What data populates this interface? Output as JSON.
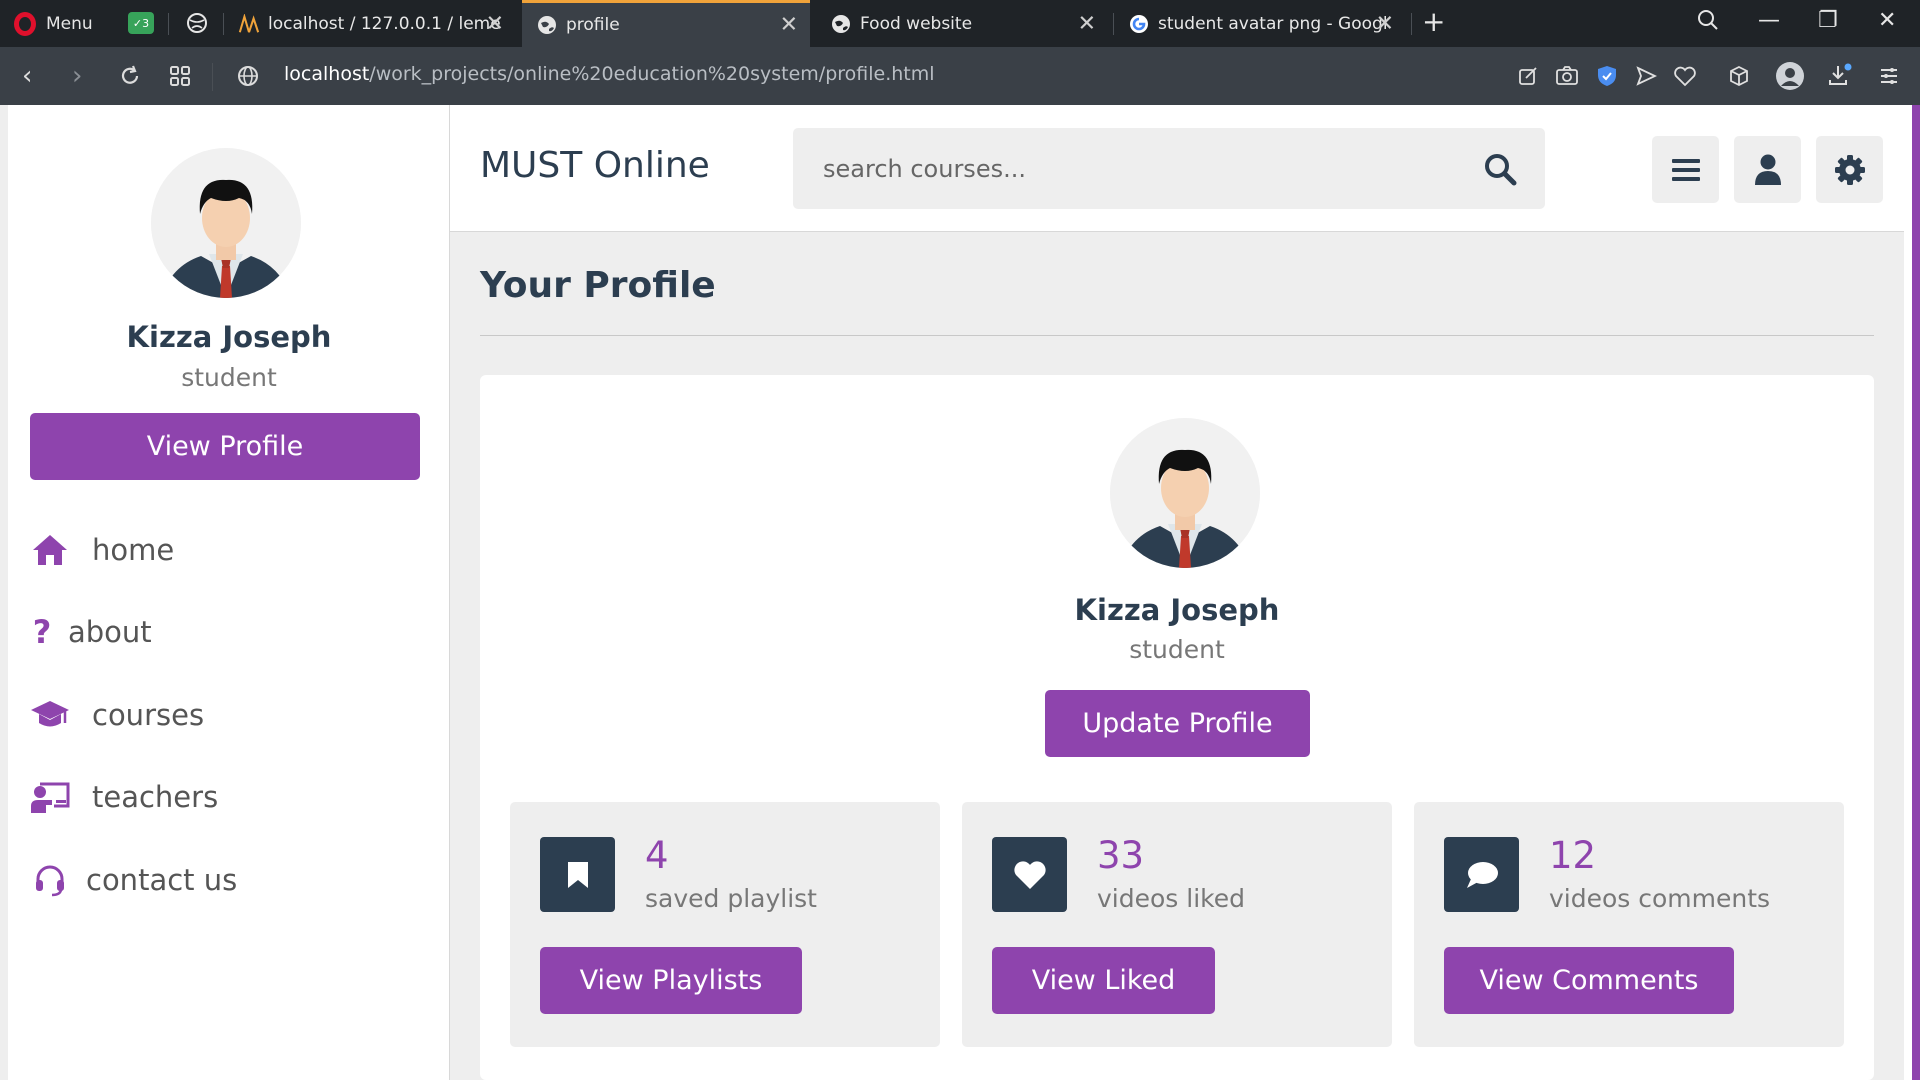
{
  "browser": {
    "menu_label": "Menu",
    "tabs": [
      {
        "title": "localhost / 127.0.0.1 / leme"
      },
      {
        "title": "profile"
      },
      {
        "title": "Food website"
      },
      {
        "title": "student avatar png - Googl"
      }
    ],
    "address": {
      "host": "localhost",
      "path": "/work_projects/online%20education%20system/profile.html"
    },
    "accent_color": "#f0a33a"
  },
  "site": {
    "logo": "MUST Online",
    "search_placeholder": "search courses...",
    "brand_color": "#8e44ad",
    "dark_color": "#2c3e50"
  },
  "sidebar": {
    "user_name": "Kizza Joseph",
    "user_role": "student",
    "view_profile_label": "View Profile",
    "nav": [
      {
        "label": "home",
        "icon": "home-icon"
      },
      {
        "label": "about",
        "icon": "question-icon"
      },
      {
        "label": "courses",
        "icon": "graduation-cap-icon"
      },
      {
        "label": "teachers",
        "icon": "chalkboard-teacher-icon"
      },
      {
        "label": "contact us",
        "icon": "headset-icon"
      }
    ]
  },
  "main": {
    "heading": "Your Profile",
    "profile": {
      "name": "Kizza Joseph",
      "role": "student",
      "update_label": "Update Profile"
    },
    "stats": [
      {
        "count": "4",
        "label": "saved playlist",
        "button": "View Playlists",
        "icon": "bookmark-icon"
      },
      {
        "count": "33",
        "label": "videos liked",
        "button": "View Liked",
        "icon": "heart-icon"
      },
      {
        "count": "12",
        "label": "videos comments",
        "button": "View Comments",
        "icon": "comment-icon"
      }
    ]
  }
}
